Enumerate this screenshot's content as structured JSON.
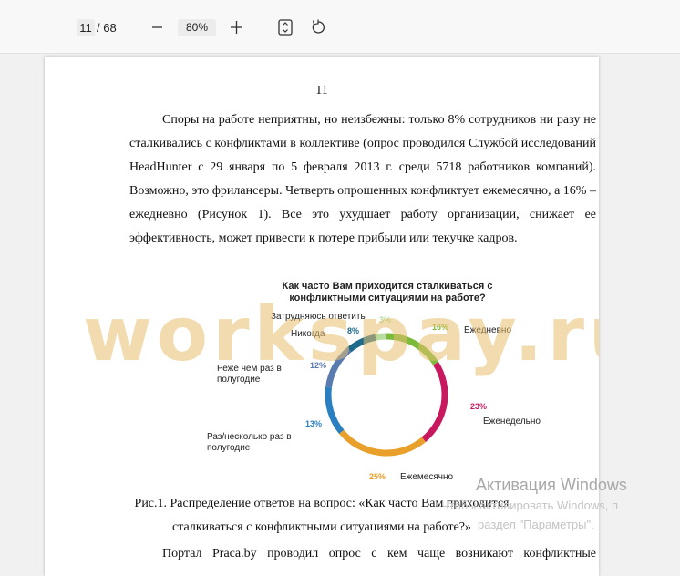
{
  "toolbar": {
    "current_page": "11",
    "total_pages": "/ 68",
    "zoom": "80%",
    "zoom_out_icon": "minus-icon",
    "zoom_in_icon": "plus-icon",
    "fit_icon": "fit-page-icon",
    "rotate_icon": "rotate-icon"
  },
  "document": {
    "page_number": "11",
    "paragraph": "Споры на работе неприятны, но неизбежны: только 8% сотрудников ни разу не сталкивались с конфликтами в коллективе (опрос проводился Службой исследований HeadHunter с 29 января по 5 февраля 2013 г. среди 5718 работников компаний). Возможно, это фрилансеры. Четверть опрошенных конфликтует ежемесячно, а 16% – ежедневно (Рисунок 1). Все это ухудшает работу организации, снижает ее эффективность, может привести к потере прибыли или текучке кадров.",
    "watermark": "workspay.ru",
    "caption_line1": "Рис.1. Распределение ответов на вопрос: «Как часто Вам приходится",
    "caption_line2": "сталкиваться с конфликтными ситуациями на работе?»",
    "next_paragraph_start": "Портал Praca.by проводил опрос с кем чаще возникают конфликтные"
  },
  "chart_data": {
    "type": "pie",
    "style": "donut",
    "title": "Как часто Вам приходится сталкиваться с конфликтными ситуациями на работе?",
    "slices": [
      {
        "label": "Ежедневно",
        "value": 16,
        "display": "16%",
        "color": "#7cbb3a"
      },
      {
        "label": "Еженедельно",
        "value": 23,
        "display": "23%",
        "color": "#c8185e"
      },
      {
        "label": "Ежемесячно",
        "value": 25,
        "display": "25%",
        "color": "#e8a02a"
      },
      {
        "label": "Раз/несколько раз в полугодие",
        "value": 13,
        "display": "13%",
        "color": "#2a7fc0"
      },
      {
        "label": "Реже чем раз в полугодие",
        "value": 12,
        "display": "12%",
        "color": "#5a7bb0"
      },
      {
        "label": "Никогда",
        "value": 8,
        "display": "8%",
        "color": "#1e6a8a"
      },
      {
        "label": "Затрудняюсь ответить",
        "value": 3,
        "display": "3%",
        "color": "#b9dca0"
      }
    ]
  },
  "os_overlay": {
    "activation_title": "Активация Windows",
    "activation_line1": "Чтобы активировать Windows, п",
    "activation_line2": "раздел \"Параметры\"."
  },
  "colors": {
    "toolbar_bg": "#f8f8f8",
    "page_bg": "#ffffff",
    "watermark": "#e6be6e"
  }
}
